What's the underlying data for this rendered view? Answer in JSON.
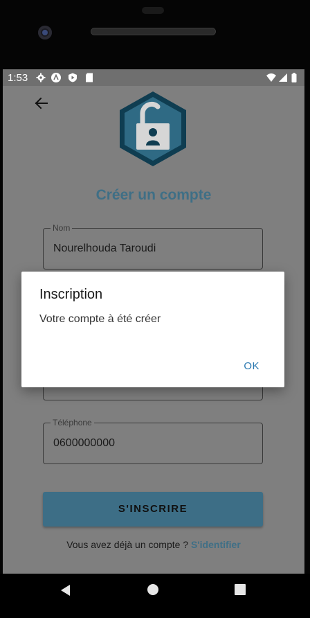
{
  "status_bar": {
    "time": "1:53",
    "icons": [
      "gear-icon",
      "app-circle-icon",
      "shield-icon",
      "sd-card-icon",
      "wifi-icon",
      "signal-icon",
      "battery-icon"
    ]
  },
  "header": {
    "back_icon": "arrow-left-icon",
    "logo_icon": "unlocked-padlock-hexagon-icon",
    "title": "Créer un compte"
  },
  "form": {
    "fields": [
      {
        "label": "Nom",
        "value": "Nourelhouda Taroudi"
      },
      {
        "label": "",
        "value": ""
      },
      {
        "label": "Téléphone",
        "value": "0600000000"
      }
    ],
    "submit_label": "S'INSCRIRE",
    "signin_prompt": "Vous avez déjà un compte ?",
    "signin_link": "S'identifier"
  },
  "dialog": {
    "title": "Inscription",
    "message": "Votre compte à été créer",
    "ok_label": "OK"
  },
  "colors": {
    "accent": "#3f6f86",
    "dialog_button": "#2a78b0",
    "overlay_background": "#7f7f7f"
  },
  "nav_bar": {
    "icons": [
      "nav-back-icon",
      "nav-home-icon",
      "nav-recent-apps-icon"
    ]
  }
}
